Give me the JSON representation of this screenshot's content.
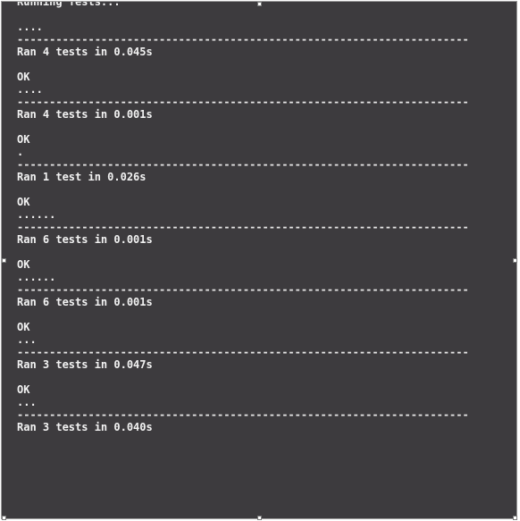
{
  "window": {
    "background": "#3d3b3e",
    "text_color": "#f2f2f2"
  },
  "console": {
    "lines": [
      "Running Tests...",
      "",
      "....",
      "----------------------------------------------------------------------",
      "Ran 4 tests in 0.045s",
      "",
      "OK",
      "....",
      "----------------------------------------------------------------------",
      "Ran 4 tests in 0.001s",
      "",
      "OK",
      ".",
      "----------------------------------------------------------------------",
      "Ran 1 test in 0.026s",
      "",
      "OK",
      "......",
      "----------------------------------------------------------------------",
      "Ran 6 tests in 0.001s",
      "",
      "OK",
      "......",
      "----------------------------------------------------------------------",
      "Ran 6 tests in 0.001s",
      "",
      "OK",
      "...",
      "----------------------------------------------------------------------",
      "Ran 3 tests in 0.047s",
      "",
      "OK",
      "...",
      "----------------------------------------------------------------------",
      "Ran 3 tests in 0.040s"
    ]
  }
}
